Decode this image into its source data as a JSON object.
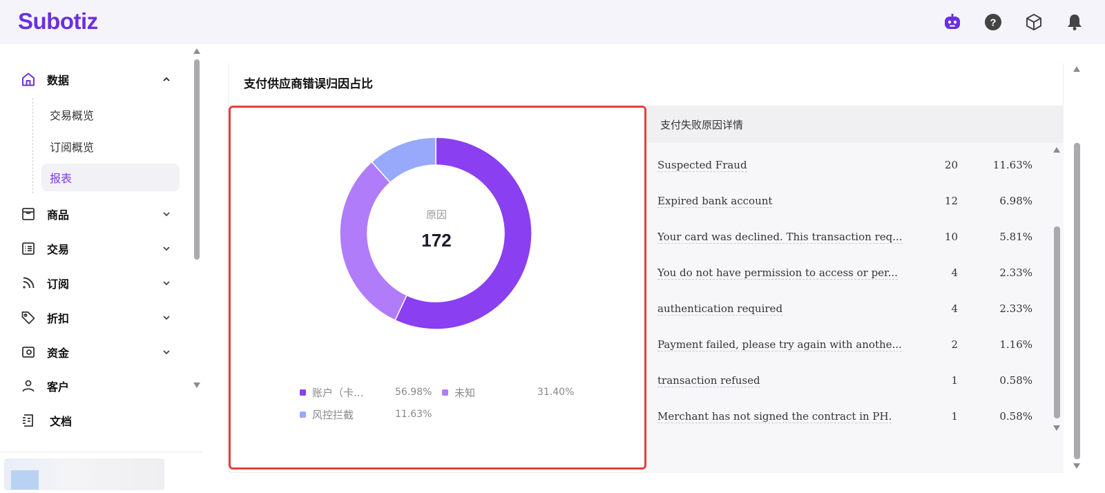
{
  "app": {
    "brand": "Subotiz"
  },
  "topbar": {
    "icons": [
      "assistant-bot-icon",
      "help-icon",
      "package-icon",
      "bell-icon"
    ]
  },
  "sidebar": {
    "items": [
      {
        "label": "数据",
        "icon": "home-icon",
        "expanded": true
      },
      {
        "label": "商品",
        "icon": "store-icon"
      },
      {
        "label": "交易",
        "icon": "list-icon"
      },
      {
        "label": "订阅",
        "icon": "rss-icon"
      },
      {
        "label": "折扣",
        "icon": "tag-icon"
      },
      {
        "label": "资金",
        "icon": "wallet-icon"
      },
      {
        "label": "客户",
        "icon": "user-icon"
      },
      {
        "label": "文档",
        "icon": "document-icon"
      }
    ],
    "sub_items": [
      {
        "label": "交易概览"
      },
      {
        "label": "订阅概览"
      },
      {
        "label": "报表",
        "active": true
      }
    ]
  },
  "card": {
    "title": "支付供应商错误归因占比"
  },
  "chart_data": {
    "type": "pie",
    "title": "",
    "center_label": "原因",
    "center_value": "172",
    "series": [
      {
        "name": "账户（卡...",
        "value": 56.98,
        "label": "56.98%",
        "color": "#8a3ff0"
      },
      {
        "name": "未知",
        "value": 31.4,
        "label": "31.40%",
        "color": "#b07cfa"
      },
      {
        "name": "风控拦截",
        "value": 11.63,
        "label": "11.63%",
        "color": "#98a8fb"
      }
    ],
    "legend_placement": "bottom"
  },
  "details": {
    "header": "支付失败原因详情",
    "rows": [
      {
        "reason": "Suspected Fraud",
        "count": "20",
        "percent": "11.63%"
      },
      {
        "reason": "Expired bank account",
        "count": "12",
        "percent": "6.98%"
      },
      {
        "reason": "Your card was declined. This transaction req...",
        "count": "10",
        "percent": "5.81%"
      },
      {
        "reason": "You do not have permission to access or per...",
        "count": "4",
        "percent": "2.33%"
      },
      {
        "reason": "authentication required",
        "count": "4",
        "percent": "2.33%"
      },
      {
        "reason": "Payment failed, please try again with anothe...",
        "count": "2",
        "percent": "1.16%"
      },
      {
        "reason": "transaction refused",
        "count": "1",
        "percent": "0.58%"
      },
      {
        "reason": "Merchant has not signed the contract in PH.",
        "count": "1",
        "percent": "0.58%"
      }
    ]
  },
  "colors": {
    "accent": "#7c3aed",
    "highlight_border": "#e53e3e"
  }
}
